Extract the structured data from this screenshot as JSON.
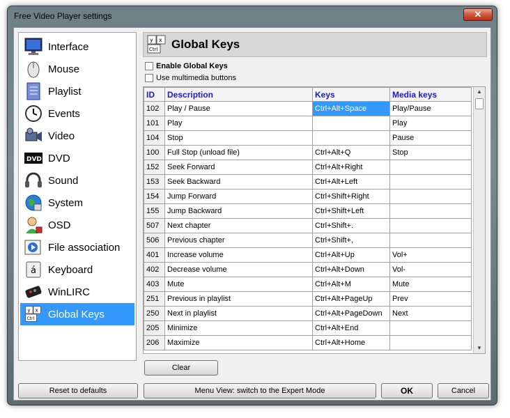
{
  "window": {
    "title": "Free Video Player settings",
    "close_glyph": "✕"
  },
  "sidebar": {
    "items": [
      {
        "label": "Interface",
        "icon": "monitor-icon"
      },
      {
        "label": "Mouse",
        "icon": "mouse-icon"
      },
      {
        "label": "Playlist",
        "icon": "playlist-icon"
      },
      {
        "label": "Events",
        "icon": "clock-icon"
      },
      {
        "label": "Video",
        "icon": "video-camera-icon"
      },
      {
        "label": "DVD",
        "icon": "dvd-icon"
      },
      {
        "label": "Sound",
        "icon": "headphones-icon"
      },
      {
        "label": "System",
        "icon": "globe-icon"
      },
      {
        "label": "OSD",
        "icon": "person-icon"
      },
      {
        "label": "File association",
        "icon": "file-association-icon"
      },
      {
        "label": "Keyboard",
        "icon": "keyboard-key-icon"
      },
      {
        "label": "WinLIRC",
        "icon": "remote-control-icon"
      },
      {
        "label": "Global Keys",
        "icon": "global-keys-icon"
      }
    ],
    "active_index": 12
  },
  "panel": {
    "title": "Global Keys",
    "enable_global_keys": "Enable Global Keys",
    "use_multimedia": "Use multimedia buttons"
  },
  "table": {
    "headers": [
      "ID",
      "Description",
      "Keys",
      "Media keys"
    ],
    "rows": [
      [
        "102",
        "Play / Pause",
        "Ctrl+Alt+Space",
        "Play/Pause"
      ],
      [
        "101",
        "Play",
        "",
        "Play"
      ],
      [
        "104",
        "Stop",
        "",
        "Pause"
      ],
      [
        "100",
        "Full Stop (unload file)",
        "Ctrl+Alt+Q",
        "Stop"
      ],
      [
        "152",
        "Seek Forward",
        "Ctrl+Alt+Right",
        ""
      ],
      [
        "153",
        "Seek Backward",
        "Ctrl+Alt+Left",
        ""
      ],
      [
        "154",
        "Jump Forward",
        "Ctrl+Shift+Right",
        ""
      ],
      [
        "155",
        "Jump Backward",
        "Ctrl+Shift+Left",
        ""
      ],
      [
        "507",
        "Next chapter",
        "Ctrl+Shift+.",
        ""
      ],
      [
        "506",
        "Previous chapter",
        "Ctrl+Shift+,",
        ""
      ],
      [
        "401",
        "Increase volume",
        "Ctrl+Alt+Up",
        "Vol+"
      ],
      [
        "402",
        "Decrease volume",
        "Ctrl+Alt+Down",
        "Vol-"
      ],
      [
        "403",
        "Mute",
        "Ctrl+Alt+M",
        "Mute"
      ],
      [
        "251",
        "Previous in playlist",
        "Ctrl+Alt+PageUp",
        "Prev"
      ],
      [
        "250",
        "Next in playlist",
        "Ctrl+Alt+PageDown",
        "Next"
      ],
      [
        "205",
        "Minimize",
        "Ctrl+Alt+End",
        ""
      ],
      [
        "206",
        "Maximize",
        "Ctrl+Alt+Home",
        ""
      ]
    ]
  },
  "buttons": {
    "clear": "Clear",
    "reset": "Reset to defaults",
    "menu_view": "Menu View: switch to the Expert Mode",
    "ok": "OK",
    "cancel": "Cancel"
  },
  "colors": {
    "selection": "#3399ff",
    "header_text": "#1a1ad6"
  }
}
